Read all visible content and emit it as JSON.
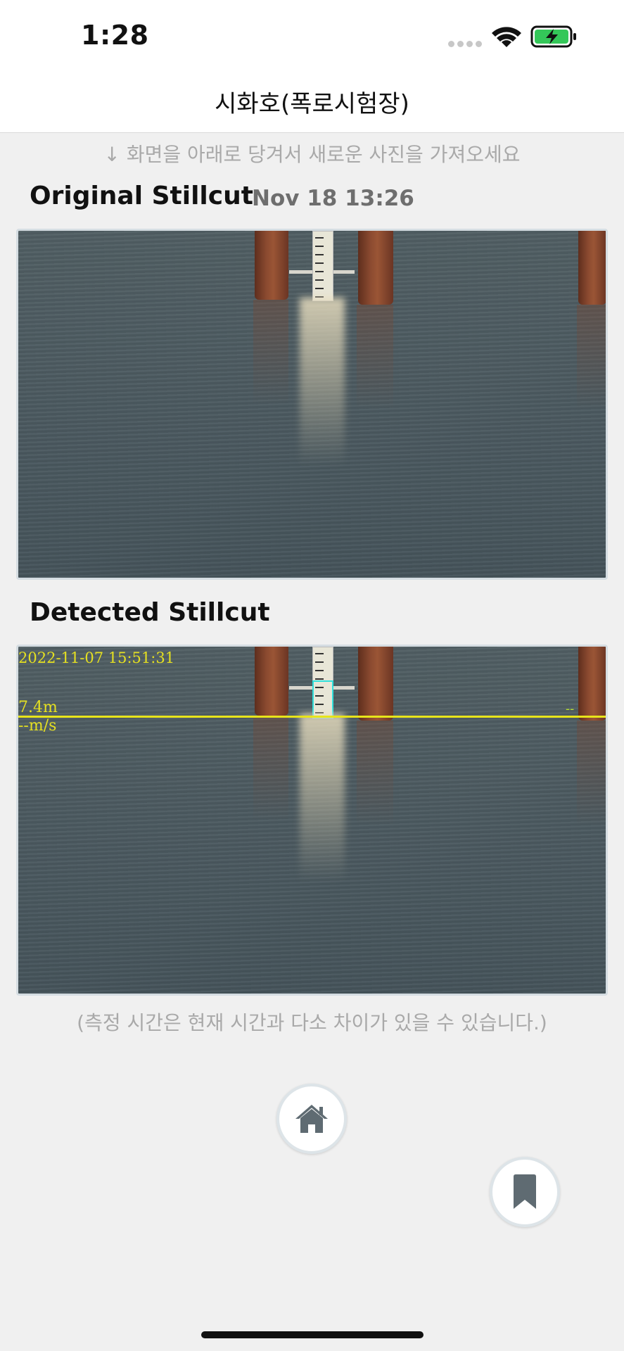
{
  "status_bar": {
    "time": "1:28"
  },
  "header": {
    "title": "시화호(폭로시험장)"
  },
  "hint": "↓ 화면을 아래로 당겨서 새로운 사진을 가져오세요",
  "original": {
    "title": "Original Stillcut",
    "timestamp": "Nov 18 13:26"
  },
  "detected": {
    "title": "Detected Stillcut",
    "overlay_datetime": "2022-11-07 15:51:31",
    "overlay_level": "7.4m",
    "overlay_velocity": "--m/s",
    "overlay_right": "--"
  },
  "caption": "(측정 시간은 현재 시간과 다소 차이가 있을 수 있습니다.)",
  "buttons": {
    "home_icon": "home-icon",
    "bookmark_icon": "bookmark-icon"
  },
  "colors": {
    "overlay_yellow": "#e5e021",
    "detect_cyan": "#2fe0dc",
    "icon_gray": "#5f6b72"
  }
}
